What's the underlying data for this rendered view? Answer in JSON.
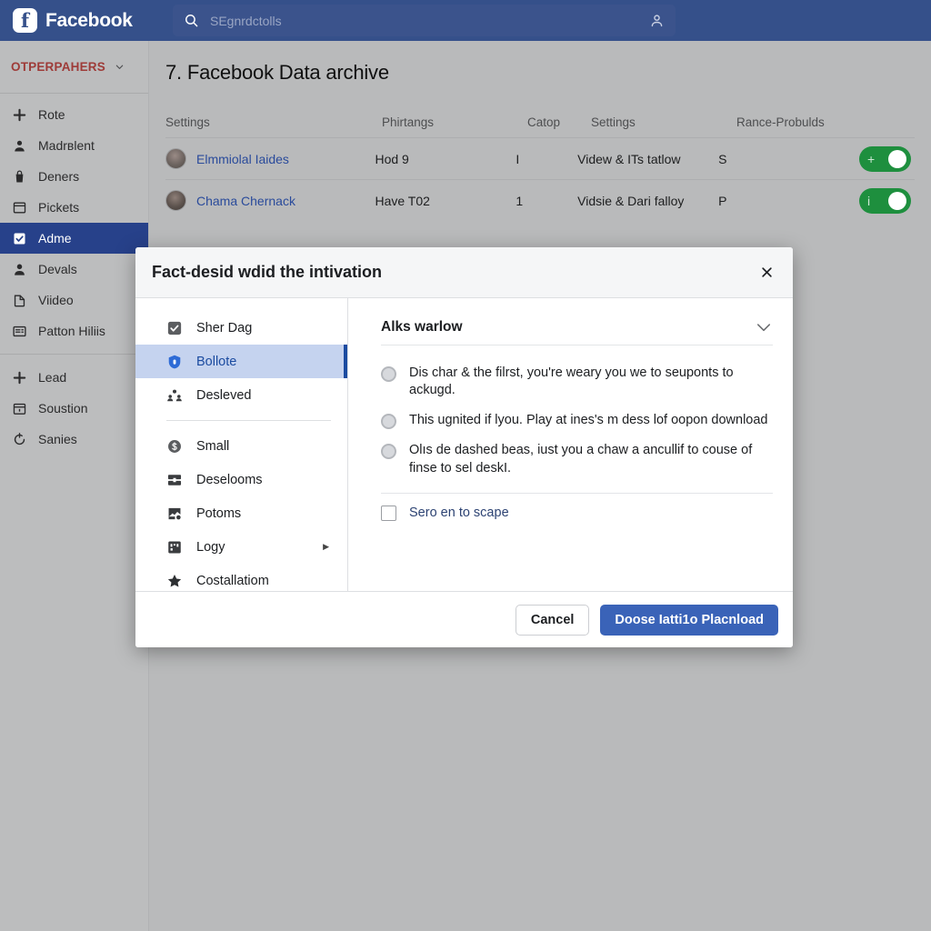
{
  "topbar": {
    "brand": "Facebook",
    "brand_mark": "f",
    "search_icon": "search-icon",
    "search_placeholder": "SEgnrdctolls",
    "account_icon": "person-icon",
    "bg": "#35508a"
  },
  "sidebar": {
    "header_label": "OTPERPAHERS",
    "groups": [
      {
        "items": [
          {
            "label": "Rote",
            "icon": "plus-icon"
          },
          {
            "label": "Madrвlent",
            "icon": "person-icon"
          },
          {
            "label": "Deners",
            "icon": "bag-icon"
          },
          {
            "label": "Pickets",
            "icon": "window-icon"
          },
          {
            "label": "Adme",
            "icon": "checkbox-icon",
            "active": true
          },
          {
            "label": "Devals",
            "icon": "person-filled-icon"
          },
          {
            "label": "Viideo",
            "icon": "page-icon"
          },
          {
            "label": "Patton Hiliis",
            "icon": "list-card-icon"
          }
        ]
      },
      {
        "items": [
          {
            "label": "Lead",
            "icon": "plus-icon"
          },
          {
            "label": "Soustion",
            "icon": "calendar-icon"
          },
          {
            "label": "Sanies",
            "icon": "refresh-icon"
          }
        ]
      }
    ]
  },
  "main": {
    "page_title": "7. Facebook Data archive",
    "table": {
      "columns": [
        "Settings",
        "Phirtangs",
        "Catop",
        "Settings",
        "Rance-Probulds"
      ],
      "rows": [
        {
          "name": "Elmmiolal Iaides",
          "col2": "Hod 9",
          "col3": "I",
          "col4": "Videw & ITs tatlow",
          "col5": "S",
          "toggle_mark": "+",
          "toggle_on": true
        },
        {
          "name": "Chama Chernack",
          "col2": "Have T02",
          "col3": "1",
          "col4": "Vidsie & Dari falloy",
          "col5": "P",
          "toggle_mark": "i",
          "toggle_on": true
        }
      ]
    }
  },
  "modal": {
    "title": "Fact-desid wdid the intivation",
    "close_icon": "close-icon",
    "menu": [
      {
        "label": "Sher Dag",
        "icon": "checkbox-checked-icon"
      },
      {
        "label": "Bollote",
        "icon": "shield-lock-icon",
        "active": true
      },
      {
        "label": "Desleved",
        "icon": "group-icon"
      },
      {
        "separator": true
      },
      {
        "label": "Small",
        "icon": "dollar-circle-icon"
      },
      {
        "label": "Deselooms",
        "icon": "card-split-icon"
      },
      {
        "label": "Potoms",
        "icon": "image-broken-icon"
      },
      {
        "label": "Logy",
        "icon": "grid-icon",
        "caret": "▶"
      },
      {
        "label": "Costallatiom",
        "icon": "star-icon"
      }
    ],
    "content": {
      "title": "Alks warlow",
      "collapse_icon": "chevron-down-icon",
      "options": [
        "Dis char & the filrst, you're weary you we to seuponts to ackugd.",
        "This ugnited if lyou. Play at ines's m dess lof oopon download",
        "Olıs de dashed beas, iust you a chaw a ancullif to couse of finse to sel deskI."
      ],
      "checkbox_label": "Sero en to scape",
      "checkbox_checked": false
    },
    "footer": {
      "cancel_label": "Cancel",
      "primary_label": "Doose Iatti1o Placnload",
      "primary_color": "#3a63b8"
    }
  }
}
